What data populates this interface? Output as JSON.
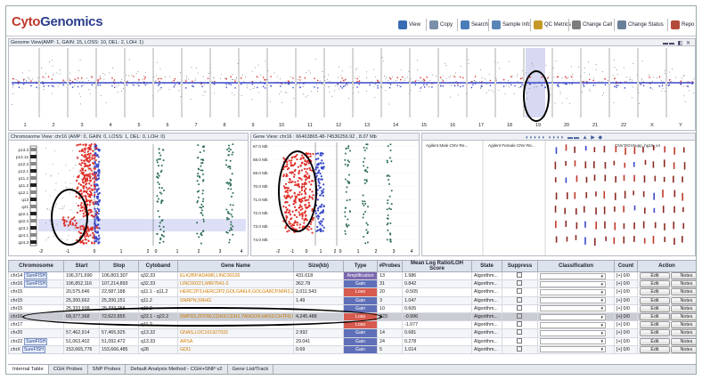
{
  "app": {
    "logo_part1": "Cyto",
    "logo_part2": "Genomics"
  },
  "toolbar": [
    {
      "label": "View",
      "icon": "view-icon",
      "color": "#3a6bb5"
    },
    {
      "label": "Copy",
      "icon": "copy-icon",
      "color": "#7a8fa8"
    },
    {
      "label": "Search",
      "icon": "search-icon",
      "color": "#4a7cb8"
    },
    {
      "label": "Sample Info",
      "icon": "sample-info-icon",
      "color": "#5a86b6"
    },
    {
      "label": "QC Metrics",
      "icon": "qc-metrics-icon",
      "color": "#c59a2a"
    },
    {
      "label": "Change Call",
      "icon": "change-call-icon",
      "color": "#7d7d7d"
    },
    {
      "label": "Change Status",
      "icon": "change-status-icon",
      "color": "#6a7f99"
    },
    {
      "label": "Repo",
      "icon": "report-icon",
      "color": "#b34a3a"
    }
  ],
  "genome_view": {
    "title": "Genome View(AMP: 1, GAIN: 15, LOSS: 10, DEL: 2, LOH: 1)",
    "chromosomes": [
      "1",
      "2",
      "3",
      "4",
      "5",
      "6",
      "7",
      "8",
      "9",
      "10",
      "11",
      "12",
      "13",
      "14",
      "15",
      "16",
      "17",
      "18",
      "19",
      "20",
      "21",
      "22",
      "X",
      "Y"
    ]
  },
  "chromosome_view": {
    "title": "Chromosome View: chr16 (AMP: 0, GAIN: 0, LOSS: 1, DEL: 0, LOH: 0)",
    "bands": [
      "p13.3",
      "p13.12",
      "p12.3",
      "p12.1",
      "p11.2",
      "q11.2",
      "q12.1",
      "q13",
      "q21",
      "q22.1",
      "q22.3",
      "q23.1",
      "q24.1",
      "q24.3"
    ],
    "xticks1": [
      "-2",
      "-1",
      "0",
      "1",
      "2"
    ],
    "xticks2": [
      "0",
      "1",
      "2",
      "3",
      "4"
    ]
  },
  "gene_view": {
    "title": "Gene View: chr16 : 66463865.48-74536256.92 , 8.07 Mb",
    "yticks": [
      "67.0 Mb",
      "68.0 Mb",
      "69.0 Mb",
      "70.0 Mb",
      "71.0 Mb",
      "72.0 Mb",
      "73.0 Mb",
      "74.0 Mb"
    ],
    "xticks1": [
      "-2",
      "-1",
      "0",
      "1",
      "2"
    ],
    "xticks2": [
      "0",
      "1",
      "2",
      "3",
      "4"
    ]
  },
  "ref_panels": [
    {
      "title": "Agilent Male CNV Re..."
    },
    {
      "title": "Agilent Female CNV Re..."
    },
    {
      "title": "CNV:DGVsupp_hg19_v4"
    }
  ],
  "table": {
    "headers": [
      "Chromosome",
      "Start",
      "Stop",
      "Cytoband",
      "Gene Name",
      "Size(kb)",
      "Type",
      "#Probes",
      "Mean Log Ratio/LOH Score",
      "State",
      "Suppress",
      "Classification",
      "Count",
      "Action"
    ],
    "rows": [
      {
        "chr": "chr14",
        "sfish": "SureFISH",
        "start": "106,371,690",
        "stop": "106,803,307",
        "cyto": "q32.33",
        "gene": "ELK2BP,ADAM6,LINC00226",
        "size": "431.618",
        "type": "Amplification",
        "probes": "13",
        "mean": "1.986",
        "state": "Algorithm...",
        "count": "[+] 0/0"
      },
      {
        "chr": "chr16",
        "sfish": "SureFISH",
        "start": "106,852,116",
        "stop": "107,214,893",
        "cyto": "q32.33",
        "gene": "LINC00221,MIR7641-2",
        "size": "362.78",
        "type": "Gain",
        "probes": "31",
        "mean": "0.842",
        "state": "Algorithm...",
        "count": "[+] 0/0"
      },
      {
        "chr": "chr15",
        "sfish": "",
        "start": "20,575,646",
        "stop": "22,587,188",
        "cyto": "q11.1 - q11.2",
        "gene": "HERC2P3,HERC2P2,GOLGA6L6,GOLGA8CP,MIR3,2,011.543",
        "size": "2,011.543",
        "type": "Loss",
        "probes": "20",
        "mean": "-0.505",
        "state": "Algorithm...",
        "count": "[+] 0/0"
      },
      {
        "chr": "chr15",
        "sfish": "",
        "start": "25,200,662",
        "stop": "25,200,151",
        "cyto": "q11.2",
        "gene": "SNRPN,SNHG",
        "size": "1.49",
        "type": "Gain",
        "probes": "3",
        "mean": "1.047",
        "state": "Algorithm...",
        "count": "[+] 0/0"
      },
      {
        "chr": "chr15",
        "sfish": "",
        "start": "25,333,938",
        "stop": "25,333,758",
        "cyto": "q11.2",
        "gene": "",
        "size": "",
        "type": "Gain",
        "probes": "10",
        "mean": "0.605",
        "state": "Algorithm...",
        "count": "[+] 0/0"
      },
      {
        "chr": "chr16",
        "sfish": "",
        "start": "68,377,368",
        "stop": "72,622,855",
        "cyto": "q22.1 - q22.2",
        "gene": "SMPD3,ZFP90,CDH3,CDH1,TANGO6,HAS3,CHTF8,UTP4,SNT",
        "size": "4,245.488",
        "type": "Loss",
        "probes": "323",
        "mean": "-0.996",
        "state": "Algorithm...",
        "count": "[+] 0/0"
      },
      {
        "chr": "chr17",
        "sfish": "",
        "start": "",
        "stop": "",
        "cyto": "q11.2",
        "gene": "",
        "size": "",
        "type": "Loss",
        "probes": "",
        "mean": "-1.077",
        "state": "Algorithm...",
        "count": "[+] 0/0"
      },
      {
        "chr": "chr20",
        "sfish": "",
        "start": "57,462,914",
        "stop": "57,465,925",
        "cyto": "q13.32",
        "gene": "GNAS,LOC101927932",
        "size": "2.992",
        "type": "Gain",
        "probes": "14",
        "mean": "0.681",
        "state": "Algorithm...",
        "count": "[+] 0/0"
      },
      {
        "chr": "chr22",
        "sfish": "SureFISH",
        "start": "51,063,402",
        "stop": "51,092,472",
        "cyto": "q13.33",
        "gene": "ARSA",
        "size": "29.041",
        "type": "Gain",
        "probes": "24",
        "mean": "0.278",
        "state": "Algorithm...",
        "count": "[+] 0/0"
      },
      {
        "chrX": "",
        "chr": "chrX",
        "sfish": "SureFISH",
        "start": "153,665,776",
        "stop": "153,666,485",
        "cyto": "q28",
        "gene": "GDI1",
        "size": "0.69",
        "type": "Gain",
        "probes": "5",
        "mean": "1.014",
        "state": "Algorithm...",
        "count": "[+] 0/0"
      }
    ],
    "edit_label": "Edit",
    "notes_label": "Notes"
  },
  "tabs": [
    "Internal Table",
    "CGH Probes",
    "SNP Probes",
    "Default Analysis Method - CGH+SNP v2",
    "Gene List/Track"
  ],
  "colors": {
    "loss": "#d65a4e",
    "gain": "#5f6fb8",
    "amp": "#7b68ae",
    "probe_red": "#e0302a",
    "probe_blue": "#3a49c8",
    "snp_green": "#2e6e55"
  }
}
